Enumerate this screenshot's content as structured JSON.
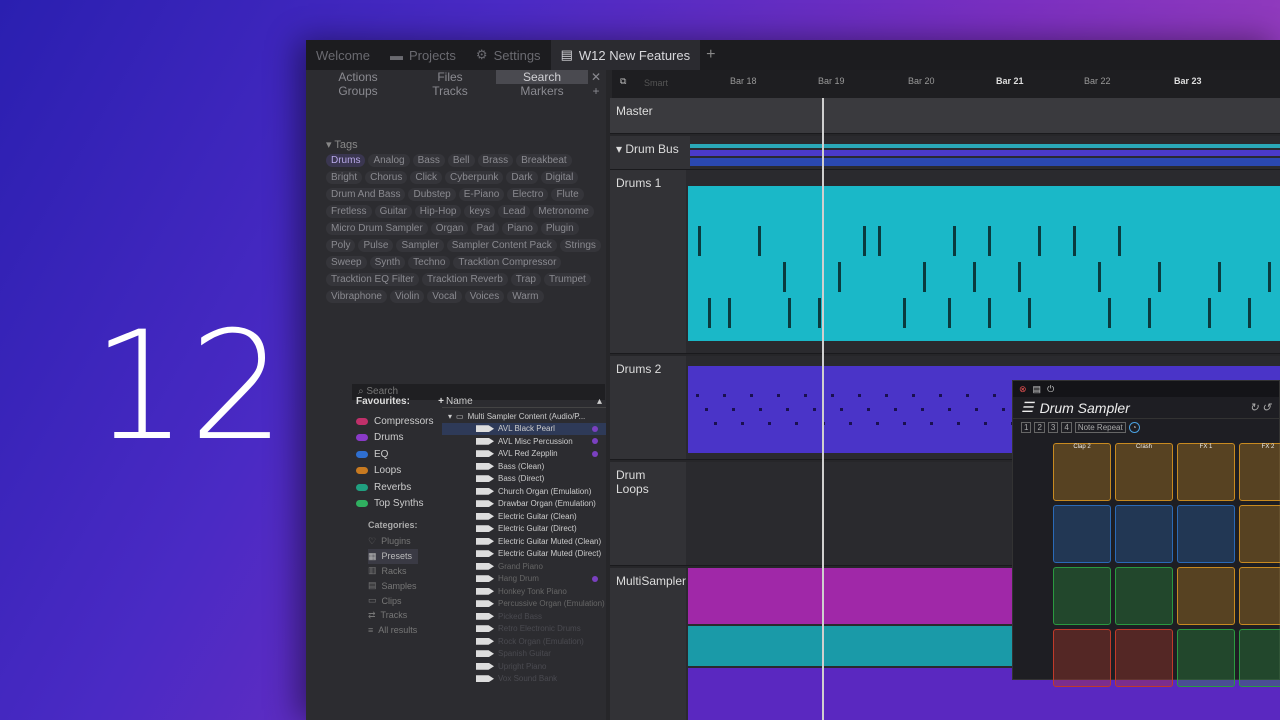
{
  "version_number": "12",
  "tabs": [
    {
      "label": "Welcome",
      "icon": "",
      "active": false
    },
    {
      "label": "Projects",
      "icon": "folder-icon",
      "active": false
    },
    {
      "label": "Settings",
      "icon": "gear-icon",
      "active": false
    },
    {
      "label": "W12 New Features",
      "icon": "layout-icon",
      "active": true
    }
  ],
  "left_nav": {
    "row1": [
      "Actions",
      "Files",
      "Search"
    ],
    "row2": [
      "Groups",
      "Tracks",
      "Markers"
    ]
  },
  "tags": {
    "header": "Tags",
    "items": [
      "Drums",
      "Analog",
      "Bass",
      "Bell",
      "Brass",
      "Breakbeat",
      "Bright",
      "Chorus",
      "Click",
      "Cyberpunk",
      "Dark",
      "Digital",
      "Drum And Bass",
      "Dubstep",
      "E-Piano",
      "Electro",
      "Flute",
      "Fretless",
      "Guitar",
      "Hip-Hop",
      "keys",
      "Lead",
      "Metronome",
      "Micro Drum Sampler",
      "Organ",
      "Pad",
      "Piano",
      "Plugin",
      "Poly",
      "Pulse",
      "Sampler",
      "Sampler Content Pack",
      "Strings",
      "Sweep",
      "Synth",
      "Techno",
      "Tracktion Compressor",
      "Tracktion EQ Filter",
      "Tracktion Reverb",
      "Trap",
      "Trumpet",
      "Vibraphone",
      "Violin",
      "Vocal",
      "Voices",
      "Warm"
    ]
  },
  "search_placeholder": "Search",
  "favourites": {
    "header": "Favourites:",
    "items": [
      {
        "label": "Compressors",
        "color": "#c0306a"
      },
      {
        "label": "Drums",
        "color": "#8a3ac8"
      },
      {
        "label": "EQ",
        "color": "#2f6fd0"
      },
      {
        "label": "Loops",
        "color": "#c87a20"
      },
      {
        "label": "Reverbs",
        "color": "#20a080"
      },
      {
        "label": "Top Synths",
        "color": "#30b060"
      }
    ]
  },
  "categories": {
    "header": "Categories:",
    "items": [
      "Plugins",
      "Presets",
      "Racks",
      "Samples",
      "Clips",
      "Tracks",
      "All results"
    ]
  },
  "tree": {
    "header": "Name",
    "root": "Multi Sampler Content (Audio/P...",
    "items": [
      "AVL Black Pearl",
      "AVL Misc Percussion",
      "AVL Red Zepplin",
      "Bass (Clean)",
      "Bass (Direct)",
      "Church Organ (Emulation)",
      "Drawbar Organ (Emulation)",
      "Electric Guitar (Clean)",
      "Electric Guitar (Direct)",
      "Electric Guitar Muted (Clean)",
      "Electric Guitar Muted (Direct)",
      "Grand Piano",
      "Hang Drum",
      "Honkey Tonk Piano",
      "Percussive Organ (Emulation)",
      "Picked Bass",
      "Retro Electronic Drums",
      "Rock Organ (Emulation)",
      "Spanish Guitar",
      "Upright Piano",
      "Vox Sound Bank"
    ]
  },
  "ruler": {
    "smart_label": "Smart",
    "bars": [
      "Bar 18",
      "Bar 19",
      "Bar 20",
      "Bar 21",
      "Bar 22",
      "Bar 23"
    ]
  },
  "tracks": [
    "Master",
    "Drum Bus",
    "Drums 1",
    "Drums 2",
    "Drum Loops",
    "MultiSampler"
  ],
  "drum_sampler": {
    "title": "Drum Sampler",
    "note_repeat": "Note Repeat",
    "pads_row1": [
      "Clap 2",
      "Crash",
      "FX 1",
      "FX 2"
    ]
  }
}
